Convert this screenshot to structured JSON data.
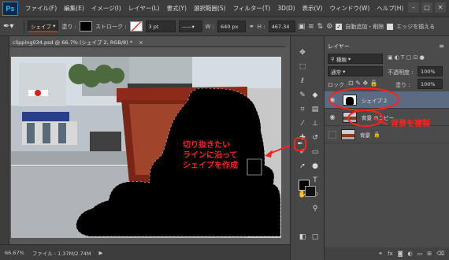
{
  "app": {
    "logo": "Ps"
  },
  "menu": [
    "ファイル(F)",
    "編集(E)",
    "イメージ(I)",
    "レイヤー(L)",
    "書式(Y)",
    "選択範囲(S)",
    "フィルター(T)",
    "3D(D)",
    "表示(V)",
    "ウィンドウ(W)",
    "ヘルプ(H)"
  ],
  "window_controls": {
    "minimize": "–",
    "restore": "□",
    "close": "✕"
  },
  "options": {
    "shape_mode": "シェイプ",
    "fill_label": "塗り :",
    "stroke_label": "ストローク :",
    "stroke_width": "3 pt",
    "w_label": "W :",
    "w_value": "640 px",
    "h_label": "H :",
    "h_value": "467.34",
    "auto_add_label": "自動追加・削除",
    "align_edges_label": "エッジを揃える",
    "colors": {
      "fill": "#000000",
      "stroke_slash": "#e03030"
    }
  },
  "document": {
    "tab_title": "clipping034.psd @ 66.7% (シェイプ 2, RGB/8) *",
    "close": "×"
  },
  "status": {
    "zoom": "66.67%",
    "file_info": "ファイル : 1.37M/2.74M"
  },
  "layers_panel": {
    "title": "レイヤー",
    "filter_label": "種類",
    "blend_mode": "通常",
    "opacity_label": "不透明度 :",
    "opacity_value": "100%",
    "lock_label": "ロック :",
    "fill_label": "塗り :",
    "fill_value": "100%",
    "layers": [
      {
        "name": "シェイプ 2",
        "selected": true
      },
      {
        "name": "背景 のコピー",
        "selected": false
      },
      {
        "name": "背景",
        "selected": false
      }
    ]
  },
  "annotations": {
    "canvas_note": [
      "切り抜きたい",
      "ラインに沿って",
      "シェイプを作成"
    ],
    "layer_note": "背景を複製",
    "color": "#ff2020"
  },
  "icons": [
    "pen-tool-icon",
    "eye-icon",
    "lock-icon",
    "layer-mask-icon",
    "trash-icon",
    "new-layer-icon",
    "fx-icon"
  ]
}
